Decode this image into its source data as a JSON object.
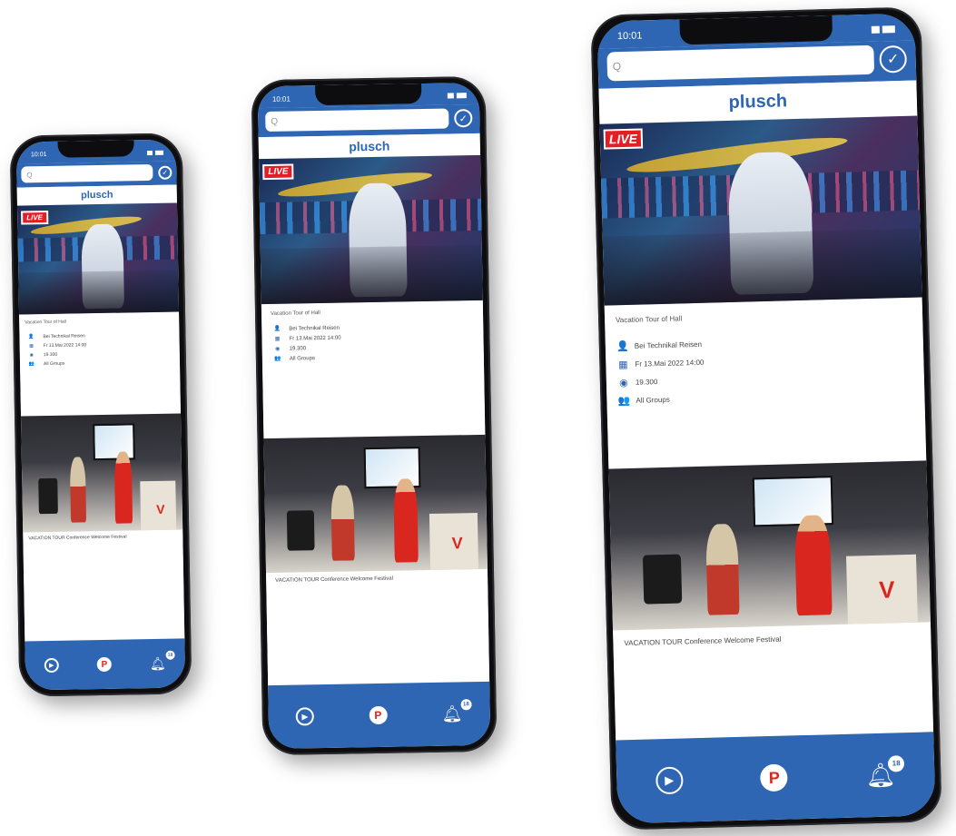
{
  "app": {
    "brand": "plusch",
    "time": "10:01",
    "search_placeholder": "Q",
    "live_label": "LIVE",
    "featured": {
      "title": "Vacation Tour of Hall",
      "organizer": "Bei Technikal Reisen",
      "date": "Fr 13.Mai 2022 14:00",
      "views": "19.300",
      "audience": "All Groups"
    },
    "second_caption": "VACATION TOUR Conference Welcome Festival",
    "tabs": {
      "play": "play-tab",
      "home_letter": "P",
      "notifications_badge": "18"
    },
    "colors": {
      "primary": "#2f66b3",
      "live": "#e31e24",
      "accent": "#d9271f"
    }
  }
}
